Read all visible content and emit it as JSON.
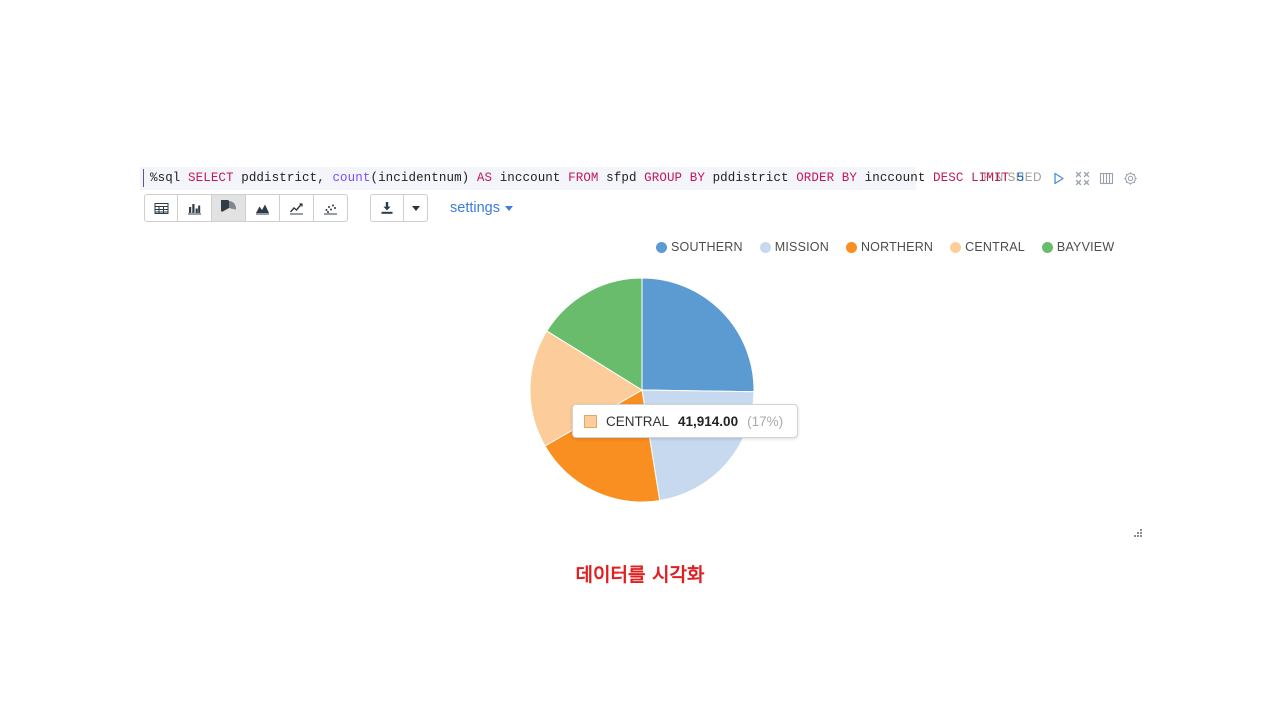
{
  "editor": {
    "query_full": "%sql SELECT pddistrict, count(incidentnum) AS inccount FROM sfpd GROUP BY pddistrict ORDER BY inccount DESC LIMIT 5",
    "tokens": [
      {
        "t": "%sql ",
        "c": "plain"
      },
      {
        "t": "SELECT ",
        "c": "kw"
      },
      {
        "t": "pddistrict, ",
        "c": "plain"
      },
      {
        "t": "count",
        "c": "fn"
      },
      {
        "t": "(incidentnum) ",
        "c": "plain"
      },
      {
        "t": "AS ",
        "c": "kw"
      },
      {
        "t": "inccount ",
        "c": "plain"
      },
      {
        "t": "FROM ",
        "c": "kw"
      },
      {
        "t": "sfpd ",
        "c": "plain"
      },
      {
        "t": "GROUP BY ",
        "c": "kw"
      },
      {
        "t": "pddistrict ",
        "c": "plain"
      },
      {
        "t": "ORDER BY ",
        "c": "kw"
      },
      {
        "t": "inccount ",
        "c": "plain"
      },
      {
        "t": "DESC ",
        "c": "kw"
      },
      {
        "t": "LIMIT ",
        "c": "kw"
      },
      {
        "t": "5",
        "c": "num"
      }
    ],
    "status": "FINISHED",
    "controls": [
      {
        "name": "run-paragraph-icon",
        "glyph": "play"
      },
      {
        "name": "hide-editor-icon",
        "glyph": "collapse"
      },
      {
        "name": "book-icon",
        "glyph": "book"
      },
      {
        "name": "gear-icon",
        "glyph": "gear"
      }
    ]
  },
  "toolbar": {
    "chart_buttons": [
      {
        "name": "table-view-button",
        "icon": "table-icon",
        "active": false
      },
      {
        "name": "bar-chart-button",
        "icon": "bar-chart-icon",
        "active": false
      },
      {
        "name": "pie-chart-button",
        "icon": "pie-chart-icon",
        "active": true
      },
      {
        "name": "area-chart-button",
        "icon": "area-chart-icon",
        "active": false
      },
      {
        "name": "line-chart-button",
        "icon": "line-chart-icon",
        "active": false
      },
      {
        "name": "scatter-chart-button",
        "icon": "scatter-chart-icon",
        "active": false
      }
    ],
    "download_button": {
      "name": "download-button",
      "icon": "download-icon"
    },
    "download_dropdown": {
      "name": "download-dropdown-button",
      "icon": "chevron-down-icon"
    },
    "settings_label": "settings"
  },
  "chart_data": {
    "type": "pie",
    "title": "",
    "legend_position": "top",
    "categories": [
      "SOUTHERN",
      "MISSION",
      "NORTHERN",
      "CENTRAL",
      "BAYVIEW"
    ],
    "values": [
      61500,
      54200,
      47000,
      41914,
      39000
    ],
    "percents": [
      25,
      22,
      19,
      17,
      16
    ],
    "colors": [
      "#5B9BD1",
      "#C6D9EF",
      "#F98E21",
      "#FCCD9A",
      "#68BC6B"
    ],
    "slices": [
      {
        "label": "SOUTHERN",
        "value": 61500,
        "percent": 25,
        "color": "#5B9BD1"
      },
      {
        "label": "MISSION",
        "value": 54200,
        "percent": 22,
        "color": "#C6D9EF"
      },
      {
        "label": "NORTHERN",
        "value": 47000,
        "percent": 19,
        "color": "#F98E21"
      },
      {
        "label": "CENTRAL",
        "value": 41914,
        "percent": 17,
        "color": "#FCCD9A"
      },
      {
        "label": "BAYVIEW",
        "value": 39000,
        "percent": 16,
        "color": "#68BC6B"
      }
    ]
  },
  "tooltip": {
    "label": "CENTRAL",
    "value": "41,914.00",
    "percent": "(17%)",
    "color": "#FCCD9A"
  },
  "caption": {
    "text": "데이터를 시각화",
    "color": "#e02020"
  }
}
